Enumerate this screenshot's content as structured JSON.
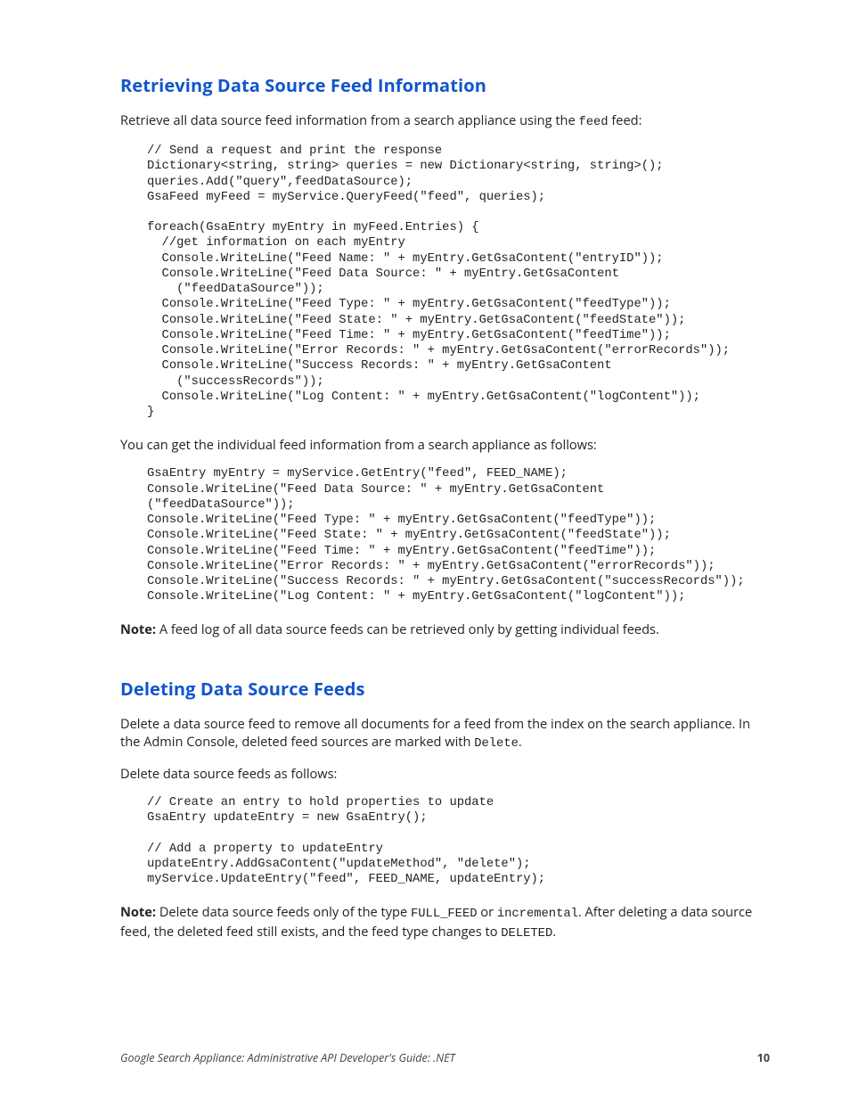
{
  "section1": {
    "heading": "Retrieving Data Source Feed Information",
    "intro_pre": "Retrieve all data source feed information from a search appliance using the ",
    "intro_code": "feed",
    "intro_post": " feed:",
    "code1": "// Send a request and print the response\nDictionary<string, string> queries = new Dictionary<string, string>();\nqueries.Add(\"query\",feedDataSource);\nGsaFeed myFeed = myService.QueryFeed(\"feed\", queries);\n\nforeach(GsaEntry myEntry in myFeed.Entries) {\n  //get information on each myEntry\n  Console.WriteLine(\"Feed Name: \" + myEntry.GetGsaContent(\"entryID\"));\n  Console.WriteLine(\"Feed Data Source: \" + myEntry.GetGsaContent\n    (\"feedDataSource\"));\n  Console.WriteLine(\"Feed Type: \" + myEntry.GetGsaContent(\"feedType\"));\n  Console.WriteLine(\"Feed State: \" + myEntry.GetGsaContent(\"feedState\"));\n  Console.WriteLine(\"Feed Time: \" + myEntry.GetGsaContent(\"feedTime\"));\n  Console.WriteLine(\"Error Records: \" + myEntry.GetGsaContent(\"errorRecords\"));\n  Console.WriteLine(\"Success Records: \" + myEntry.GetGsaContent\n    (\"successRecords\"));\n  Console.WriteLine(\"Log Content: \" + myEntry.GetGsaContent(\"logContent\"));\n}",
    "mid": "You can get the individual feed information from a search appliance as follows:",
    "code2": "GsaEntry myEntry = myService.GetEntry(\"feed\", FEED_NAME);\nConsole.WriteLine(\"Feed Data Source: \" + myEntry.GetGsaContent\n(\"feedDataSource\"));\nConsole.WriteLine(\"Feed Type: \" + myEntry.GetGsaContent(\"feedType\"));\nConsole.WriteLine(\"Feed State: \" + myEntry.GetGsaContent(\"feedState\"));\nConsole.WriteLine(\"Feed Time: \" + myEntry.GetGsaContent(\"feedTime\"));\nConsole.WriteLine(\"Error Records: \" + myEntry.GetGsaContent(\"errorRecords\"));\nConsole.WriteLine(\"Success Records: \" + myEntry.GetGsaContent(\"successRecords\"));\nConsole.WriteLine(\"Log Content: \" + myEntry.GetGsaContent(\"logContent\"));",
    "note_label": "Note:",
    "note_text": "  A feed log of all data source feeds can be retrieved only by getting individual feeds."
  },
  "section2": {
    "heading": "Deleting Data Source Feeds",
    "p1_pre": "Delete a data source feed to remove all documents for a feed from the index on the search appliance. In the Admin Console, deleted feed sources are marked with ",
    "p1_code": "Delete",
    "p1_post": ".",
    "p2": "Delete data source feeds as follows:",
    "code": "// Create an entry to hold properties to update\nGsaEntry updateEntry = new GsaEntry();\n\n// Add a property to updateEntry\nupdateEntry.AddGsaContent(\"updateMethod\", \"delete\");\nmyService.UpdateEntry(\"feed\", FEED_NAME, updateEntry);",
    "note_label": "Note:",
    "note_t1": "  Delete data source feeds only of the type ",
    "note_c1": "FULL_FEED",
    "note_t2": " or ",
    "note_c2": "incremental",
    "note_t3": ". After deleting a data source feed, the deleted feed still exists, and the feed type changes to ",
    "note_c3": "DELETED",
    "note_t4": "."
  },
  "footer": {
    "title": "Google Search Appliance: Administrative API Developer's Guide: .NET",
    "page": "10"
  }
}
